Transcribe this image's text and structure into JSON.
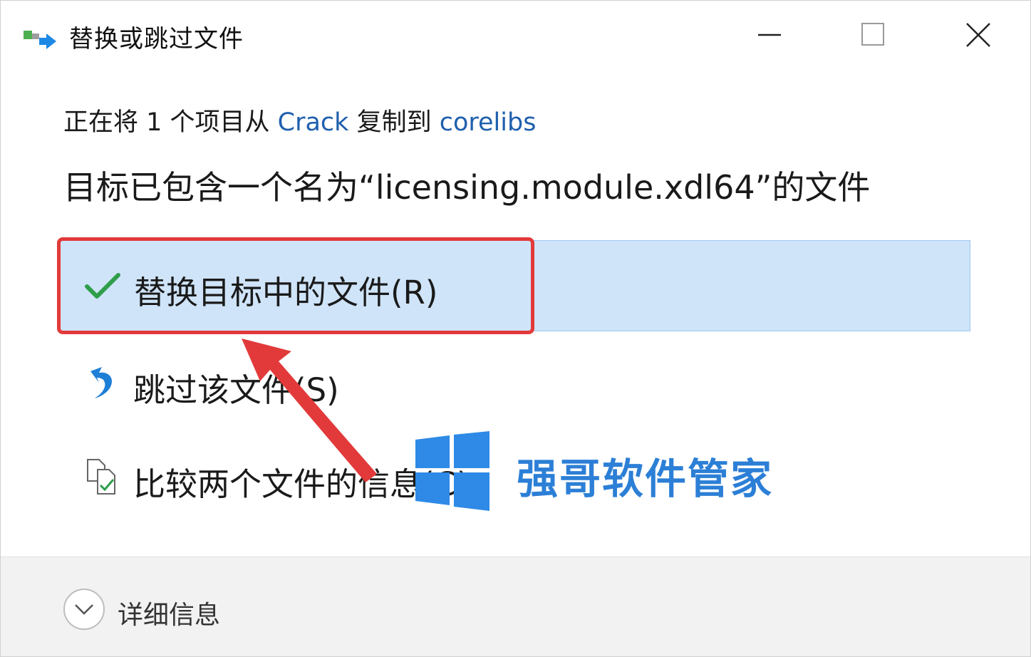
{
  "window": {
    "title": "替换或跳过文件",
    "icon": "file-transfer-icon"
  },
  "titlebar_buttons": {
    "minimize": "minimize-icon",
    "maximize": "maximize-icon",
    "close": "close-icon"
  },
  "header": {
    "copy_prefix": "正在将 1 个项目从 ",
    "source_folder": "Crack",
    "copy_mid": " 复制到 ",
    "dest_folder": "corelibs",
    "conflict_message": "目标已包含一个名为“licensing.module.xdl64”的文件"
  },
  "options": {
    "replace": {
      "label": "替换目标中的文件(R)",
      "icon": "checkmark-icon"
    },
    "skip": {
      "label": "跳过该文件(S)",
      "icon": "skip-arrow-icon"
    },
    "compare": {
      "label": "比较两个文件的信息(C)",
      "icon": "compare-files-icon"
    }
  },
  "footer": {
    "details_label": "详细信息",
    "details_icon": "chevron-down-icon"
  },
  "watermark": {
    "text": "强哥软件管家",
    "icon": "windows-logo-icon"
  },
  "colors": {
    "link": "#1f5fad",
    "selected_bg": "#cfe4f9",
    "annotation_red": "#e23a3a",
    "watermark_blue": "#2c7fd6",
    "check_green": "#2e9e4a"
  }
}
